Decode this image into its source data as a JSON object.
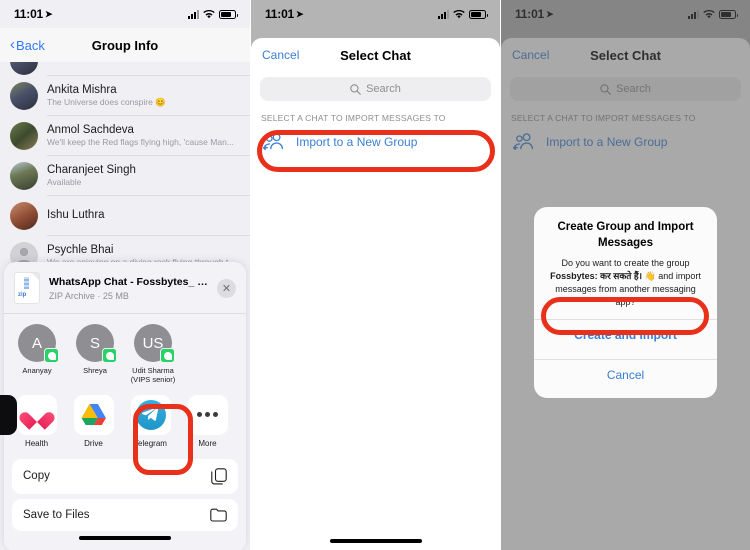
{
  "status_bar": {
    "time": "11:01",
    "location_icon": "location-arrow-icon",
    "cellular_icon": "cellular-bars-icon",
    "wifi_icon": "wifi-icon",
    "battery_icon": "battery-icon"
  },
  "panel1": {
    "nav": {
      "back_label": "Back",
      "back_icon": "chevron-left-icon",
      "title": "Group Info"
    },
    "contacts": [
      {
        "name": "Ankita Mishra",
        "status": "The Universe does conspire 😊",
        "avatar": "av-a"
      },
      {
        "name": "Anmol Sachdeva",
        "status": "We'll keep the Red flags flying high, 'cause Man...",
        "avatar": "av-b"
      },
      {
        "name": "Charanjeet Singh",
        "status": "Available",
        "avatar": "av-c"
      },
      {
        "name": "Ishu Luthra",
        "status": "",
        "avatar": "av-d"
      },
      {
        "name": "Psychle Bhai",
        "status": "We are enjoying on a diving rock flying through t",
        "avatar": "av-e"
      }
    ],
    "share_sheet": {
      "file_name": "WhatsApp Chat - Fossbytes_ कर स...",
      "file_meta": "ZIP Archive · 25 MB",
      "zip_label": "zip",
      "close_icon": "close-icon",
      "people": [
        {
          "initials": "A",
          "name": "Ananyay",
          "badge": "whatsapp-badge-icon"
        },
        {
          "initials": "S",
          "name": "Shreya",
          "badge": "whatsapp-badge-icon"
        },
        {
          "initials": "US",
          "name": "Udit Sharma (VIPS senior)",
          "badge": "whatsapp-badge-icon"
        }
      ],
      "apps": [
        {
          "name": "",
          "icon": "clipped-app-icon"
        },
        {
          "name": "Health",
          "icon": "health-icon"
        },
        {
          "name": "Drive",
          "icon": "google-drive-icon"
        },
        {
          "name": "Telegram",
          "icon": "telegram-icon"
        },
        {
          "name": "More",
          "icon": "more-dots-icon"
        }
      ],
      "actions": [
        {
          "label": "Copy",
          "icon": "copy-icon"
        },
        {
          "label": "Save to Files",
          "icon": "folder-icon"
        }
      ]
    }
  },
  "panel2": {
    "nav": {
      "cancel_label": "Cancel",
      "title": "Select Chat"
    },
    "search": {
      "placeholder": "Search",
      "icon": "search-icon"
    },
    "section_header": "Select a chat to import messages to",
    "new_group": {
      "label": "Import to a New Group",
      "icon": "add-group-icon"
    }
  },
  "panel3": {
    "nav": {
      "cancel_label": "Cancel",
      "title": "Select Chat"
    },
    "search": {
      "placeholder": "Search",
      "icon": "search-icon"
    },
    "section_header": "Select a chat to import messages to",
    "new_group": {
      "label": "Import to a New Group",
      "icon": "add-group-icon"
    },
    "alert": {
      "title": "Create Group and Import Messages",
      "message_part1": "Do you want to create the group ",
      "group_name": "Fossbytes: कर सकते हैं। 👋",
      "message_part2": " and import messages from another messaging app?",
      "confirm_label": "Create and Import",
      "cancel_label": "Cancel"
    }
  },
  "annotations": {
    "highlight_color": "#e8301a"
  }
}
